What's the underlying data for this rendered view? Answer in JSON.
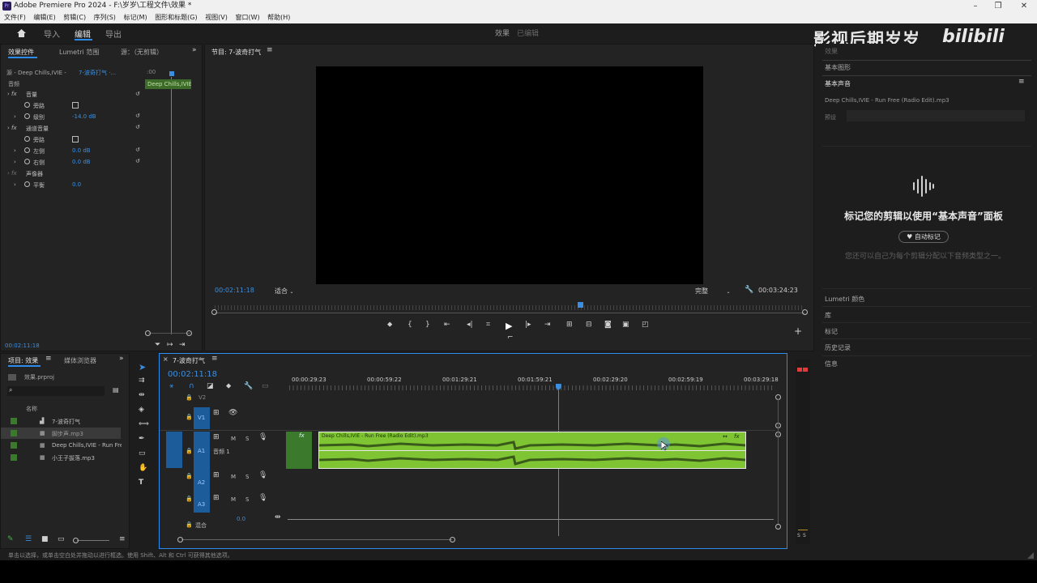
{
  "window": {
    "title": "Adobe Premiere Pro 2024 - F:\\岁岁\\工程文件\\效果 *",
    "app_icon": "Pr",
    "controls": [
      "–",
      "❐",
      "✕"
    ]
  },
  "menu": [
    "文件(F)",
    "编辑(E)",
    "剪辑(C)",
    "序列(S)",
    "标记(M)",
    "图形和标题(G)",
    "视图(V)",
    "窗口(W)",
    "帮助(H)"
  ],
  "workspace": {
    "tabs": [
      "导入",
      "编辑",
      "导出"
    ],
    "active": "编辑",
    "center_left": "效果",
    "center_right": "已编辑"
  },
  "watermark": {
    "text": "影视后期岁岁",
    "logo": "bilibili"
  },
  "effect_controls": {
    "tabs": [
      "效果控件",
      "Lumetri 范围",
      "源：（无剪辑）"
    ],
    "source": "源 - Deep Chills,IVIE -",
    "sequence": "7-波奇打气 ·...",
    "ruler_time": ":00",
    "clip_label": "Deep Chills,IVIE",
    "section": "音频",
    "rows": [
      {
        "fx": true,
        "name": "音量",
        "value": ""
      },
      {
        "name": "旁路",
        "value": "",
        "checkbox": true
      },
      {
        "name": "级别",
        "value": "-14.0 dB"
      },
      {
        "fx": true,
        "name": "通道音量",
        "value": ""
      },
      {
        "name": "旁路",
        "value": "",
        "checkbox": true
      },
      {
        "name": "左侧",
        "value": "0.0 dB"
      },
      {
        "name": "右侧",
        "value": "0.0 dB"
      },
      {
        "fx": false,
        "name": "声像器",
        "value": ""
      },
      {
        "name": "平衡",
        "value": "0.0"
      }
    ],
    "timecode": "00:02:11:18"
  },
  "program": {
    "tab": "节目: 7-波奇打气",
    "timecode_current": "00:02:11:18",
    "fit": "适合",
    "quality": "完整",
    "timecode_total": "00:03:24:23",
    "playhead_fraction": 0.62
  },
  "essential": {
    "tabs": [
      "效果",
      "基本图形",
      "基本声音"
    ],
    "file": "Deep Chills,IVIE - Run Free (Radio Edit).mp3",
    "preset_label": "预设",
    "heading": "标记您的剪辑以使用“基本声音”面板",
    "auto_button": "自动标记",
    "desc": "您还可以自己为每个剪辑分配以下音频类型之一。",
    "more_panels": [
      "Lumetri 颜色",
      "库",
      "标记",
      "历史记录",
      "信息"
    ]
  },
  "project": {
    "tabs": [
      "项目: 效果",
      "媒体浏览器"
    ],
    "file": "效果.prproj",
    "col": "名称",
    "items": [
      {
        "name": "7-波奇打气",
        "color": "#3b7a2c"
      },
      {
        "name": "脚步声.mp3",
        "color": "#3b7a2c",
        "selected": true
      },
      {
        "name": "Deep Chills,IVIE - Run Free",
        "color": "#3b7a2c"
      },
      {
        "name": "小王子拔落.mp3",
        "color": "#3b7a2c"
      }
    ]
  },
  "timeline": {
    "tab": "7-波奇打气",
    "timecode": "00:02:11:18",
    "ruler": [
      "00:00:29:23",
      "00:00:59:22",
      "00:01:29:21",
      "00:01:59:21",
      "00:02:29:20",
      "00:02:59:19",
      "00:03:29:18"
    ],
    "tracks": [
      {
        "id": "V1",
        "type": "video"
      },
      {
        "id": "A1",
        "type": "audio",
        "label": "音频 1"
      },
      {
        "id": "A2",
        "type": "audio"
      },
      {
        "id": "A3",
        "type": "audio"
      }
    ],
    "mix_label": "混合",
    "mix_value": "0.0",
    "clip_name": "Deep Chills,IVIE - Run Free (Radio Edit).mp3",
    "playhead_fraction": 0.553
  },
  "meters": {
    "labels": [
      "S",
      "S"
    ]
  },
  "status": "单击以选择，或单击空白处并拖动以进行框选。使用 Shift、Alt 和 Ctrl 可获得其他选项。"
}
